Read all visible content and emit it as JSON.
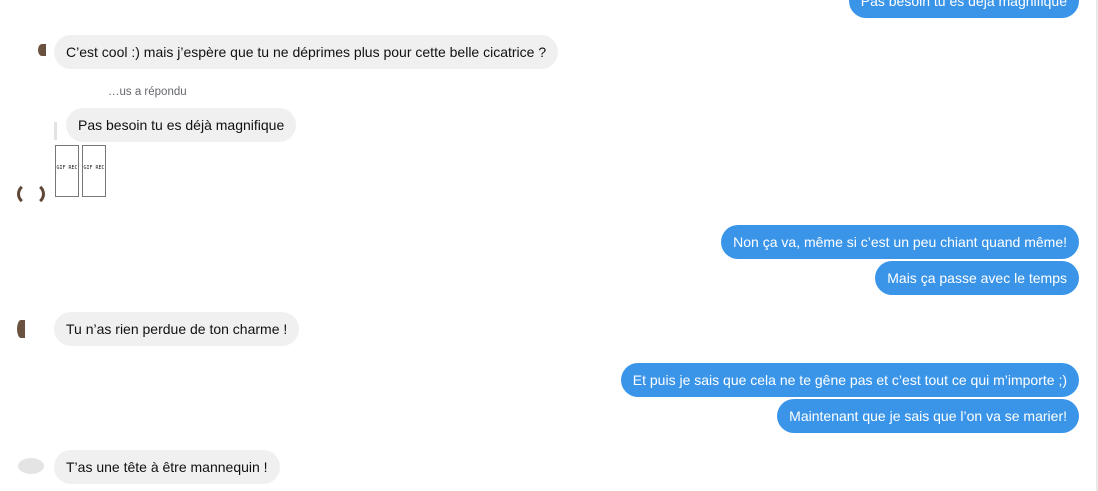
{
  "conversation": {
    "messages": [
      {
        "side": "out",
        "text": "Pas besoin tu es déjà magnifique"
      },
      {
        "side": "in",
        "text": "C’est cool :) mais j’espère que tu ne déprimes plus pour cette belle cicatrice ?"
      },
      {
        "side": "in",
        "text": "Pas besoin tu es déjà magnifique",
        "reply_label": "…us a répondu"
      },
      {
        "side": "out",
        "text": "Non ça va, même si c’est un peu chiant quand même!"
      },
      {
        "side": "out",
        "text": "Mais ça passe avec le temps"
      },
      {
        "side": "in",
        "text": "Tu n’as rien perdue de ton charme !"
      },
      {
        "side": "out",
        "text": "Et puis je sais que cela ne te gêne pas et c’est tout ce qui m’importe ;)"
      },
      {
        "side": "out",
        "text": "Maintenant que je sais que l’on va se marier!"
      },
      {
        "side": "in",
        "text": "T’as une tête à être mannequin !"
      }
    ],
    "gifs": [
      {
        "label": "GIF REC"
      },
      {
        "label": "GIF REC"
      }
    ],
    "colors": {
      "outgoing_bubble": "#3a95e9",
      "incoming_bubble": "#f0f0f0"
    }
  }
}
